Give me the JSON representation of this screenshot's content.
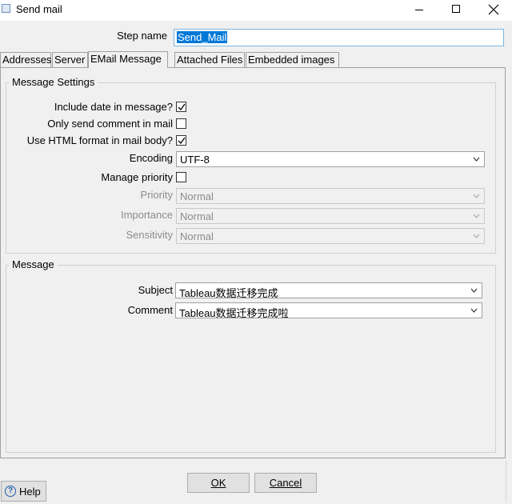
{
  "window": {
    "title": "Send mail",
    "icons": {
      "app": "document-icon",
      "minimize": "minimize-icon",
      "maximize": "maximize-icon",
      "close": "close-icon"
    }
  },
  "step": {
    "label": "Step name",
    "value": "Send_Mail"
  },
  "tabs": [
    {
      "label": "Addresses",
      "active": false
    },
    {
      "label": "Server",
      "active": false
    },
    {
      "label": "EMail Message",
      "active": true
    },
    {
      "label": "Attached Files",
      "active": false
    },
    {
      "label": "Embedded images",
      "active": false
    }
  ],
  "message_settings": {
    "title": "Message Settings",
    "include_date": {
      "label": "Include date in message?",
      "checked": true
    },
    "only_comment": {
      "label": "Only send comment in mail",
      "checked": false
    },
    "use_html": {
      "label": "Use HTML format in mail body?",
      "checked": true
    },
    "encoding": {
      "label": "Encoding",
      "value": "UTF-8"
    },
    "manage_priority": {
      "label": "Manage priority",
      "checked": false
    },
    "priority": {
      "label": "Priority",
      "value": "Normal",
      "enabled": false
    },
    "importance": {
      "label": "Importance",
      "value": "Normal",
      "enabled": false
    },
    "sensitivity": {
      "label": "Sensitivity",
      "value": "Normal",
      "enabled": false
    }
  },
  "message": {
    "title": "Message",
    "subject": {
      "label": "Subject",
      "value": "Tableau数据迁移完成"
    },
    "comment": {
      "label": "Comment",
      "value": "Tableau数据迁移完成啦"
    }
  },
  "buttons": {
    "ok": "OK",
    "cancel": "Cancel",
    "help": "Help"
  },
  "colors": {
    "selection": "#0078d7",
    "focus_border": "#7ab4e0",
    "help_icon": "#1e5fa8"
  }
}
